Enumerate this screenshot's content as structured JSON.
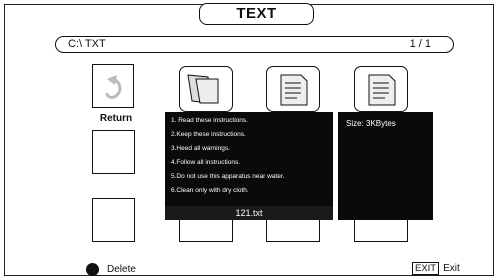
{
  "header": {
    "title": "TEXT"
  },
  "path_bar": {
    "path": "C:\\ TXT",
    "page": "1 / 1"
  },
  "grid": {
    "return_label": "Return",
    "icons": [
      "return-arrow-icon",
      "folder-document-icon",
      "text-document-icon",
      "text-document-icon"
    ]
  },
  "preview": {
    "lines": [
      "1. Read these instructions.",
      "2.Keep these instructions.",
      "3.Heed all warnings.",
      "4.Follow all instructions.",
      "5.Do not use this apparatus near water.",
      "6.Clean only with dry cloth."
    ],
    "filename": "121.txt"
  },
  "info": {
    "size": "Size:  3KBytes"
  },
  "footer": {
    "delete_label": "Delete",
    "exit_key": "EXIT",
    "exit_label": "Exit"
  }
}
